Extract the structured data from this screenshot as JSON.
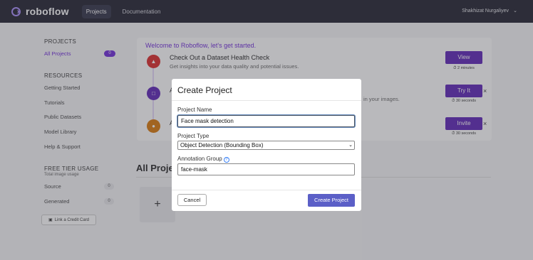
{
  "topbar": {
    "logo": "roboflow",
    "nav": [
      "Projects",
      "Documentation"
    ],
    "user": "Shakhizat Nurgaliyev"
  },
  "sidebar": {
    "projects_heading": "PROJECTS",
    "all_projects": "All Projects",
    "all_projects_count": "0",
    "resources_heading": "RESOURCES",
    "resources": [
      "Getting Started",
      "Tutorials",
      "Public Datasets",
      "Model Library",
      "Help & Support"
    ],
    "free_tier_heading": "FREE TIER USAGE",
    "free_tier_sub": "Total image usage",
    "source_label": "Source",
    "source_count": "0",
    "generated_label": "Generated",
    "generated_count": "0",
    "credit_card_button": "Link a Credit Card"
  },
  "welcome": {
    "title": "Welcome to Roboflow, let's get started.",
    "steps": [
      {
        "title": "Check Out a Dataset Health Check",
        "desc": "Get insights into your data quality and potential issues.",
        "button": "View",
        "time": "2 minutes",
        "color": "#dc2626"
      },
      {
        "title": "A",
        "desc": "in your images.",
        "button": "Try It",
        "time": "30 seconds",
        "color": "#5b21b6"
      },
      {
        "title": "A",
        "desc": "",
        "button": "Invite",
        "time": "30 seconds",
        "color": "#d97706"
      }
    ]
  },
  "main": {
    "all_projects_heading": "All Proje",
    "add_tile": "+"
  },
  "modal": {
    "title": "Create Project",
    "project_name_label": "Project Name",
    "project_name_value": "Face mask detection",
    "project_type_label": "Project Type",
    "project_type_value": "Object Detection (Bounding Box)",
    "annotation_group_label": "Annotation Group",
    "annotation_group_value": "face-mask",
    "cancel_button": "Cancel",
    "create_button": "Create Project"
  }
}
